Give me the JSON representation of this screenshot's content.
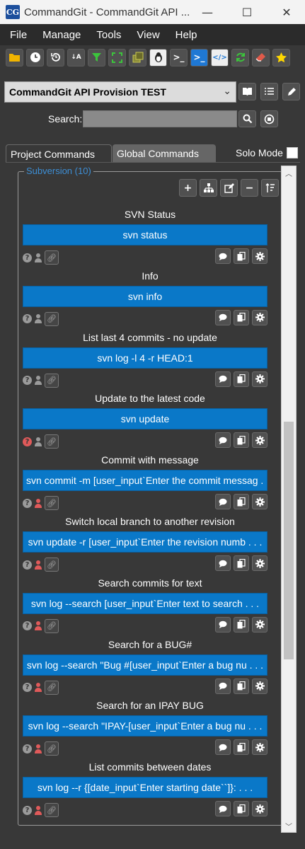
{
  "window": {
    "title": "CommandGit - CommandGit API ...",
    "logo_text": "CG",
    "controls": {
      "minimize": "—",
      "maximize": "☐",
      "close": "✕"
    }
  },
  "menu": [
    "File",
    "Manage",
    "Tools",
    "View",
    "Help"
  ],
  "toolbar": {
    "icons": [
      "folder-open-icon",
      "clock-icon",
      "history-icon",
      "sort-az-icon",
      "filter-icon",
      "fullscreen-icon",
      "layers-icon",
      "linux-icon",
      "terminal-icon",
      "powershell-icon",
      "code-icon",
      "refresh-icon",
      "eraser-icon",
      "star-icon"
    ],
    "colors": {
      "folder": "#f0b400",
      "filter": "#3cc43c",
      "powershell": "#1f78d4",
      "code": "#1f78d4",
      "refresh": "#3cc43c",
      "eraser": "#e05a4a",
      "star": "#ffd700"
    }
  },
  "provision": {
    "selected": "CommandGit API Provision TEST",
    "icons": [
      "book-icon",
      "checklist-icon",
      "pencil-icon"
    ]
  },
  "search": {
    "label": "Search:",
    "value": ""
  },
  "tabs": {
    "project": "Project Commands",
    "global": "Global Commands"
  },
  "solo_mode": {
    "label": "Solo Mode",
    "checked": false
  },
  "group": {
    "legend": "Subversion (10)",
    "actions": [
      "add-icon",
      "hierarchy-icon",
      "edit-icon",
      "minus-icon",
      "sort-icon"
    ],
    "accent_color": "#3d8fd6",
    "commands": [
      {
        "title": "SVN Status",
        "command": "svn status",
        "required_input": false,
        "help_alert": false
      },
      {
        "title": "Info",
        "command": "svn info",
        "required_input": false,
        "help_alert": false
      },
      {
        "title": "List last 4 commits - no update",
        "command": "svn log -l 4 -r HEAD:1",
        "required_input": false,
        "help_alert": false
      },
      {
        "title": "Update to the latest code",
        "command": "svn update",
        "required_input": false,
        "help_alert": true
      },
      {
        "title": "Commit with message",
        "command": "svn commit -m [user_input`Enter the commit messag . . .",
        "required_input": true,
        "help_alert": false
      },
      {
        "title": "Switch local branch to another revision",
        "command": "svn update -r [user_input`Enter the revision numb . . .",
        "required_input": true,
        "help_alert": false
      },
      {
        "title": "Search commits for text",
        "command": "svn log --search [user_input`Enter text to search . . .",
        "required_input": true,
        "help_alert": false
      },
      {
        "title": "Search for a BUG#",
        "command": "svn log --search \"Bug #[user_input`Enter a bug nu . . .",
        "required_input": true,
        "help_alert": false
      },
      {
        "title": "Search for an IPAY BUG",
        "command": "svn log --search \"IPAY-[user_input`Enter a bug nu . . .",
        "required_input": true,
        "help_alert": false
      },
      {
        "title": "List commits between dates",
        "command": "svn log --r {[date_input`Enter starting date``]}: . . .",
        "required_input": true,
        "help_alert": false
      }
    ]
  },
  "colors": {
    "background": "#383838",
    "menu_bar": "#2b2b2b",
    "command_button": "#0a78c8",
    "required_input_icon": "#e05a5a"
  },
  "scrollbar": {
    "position": 0.6,
    "visible_fraction": 0.37
  }
}
